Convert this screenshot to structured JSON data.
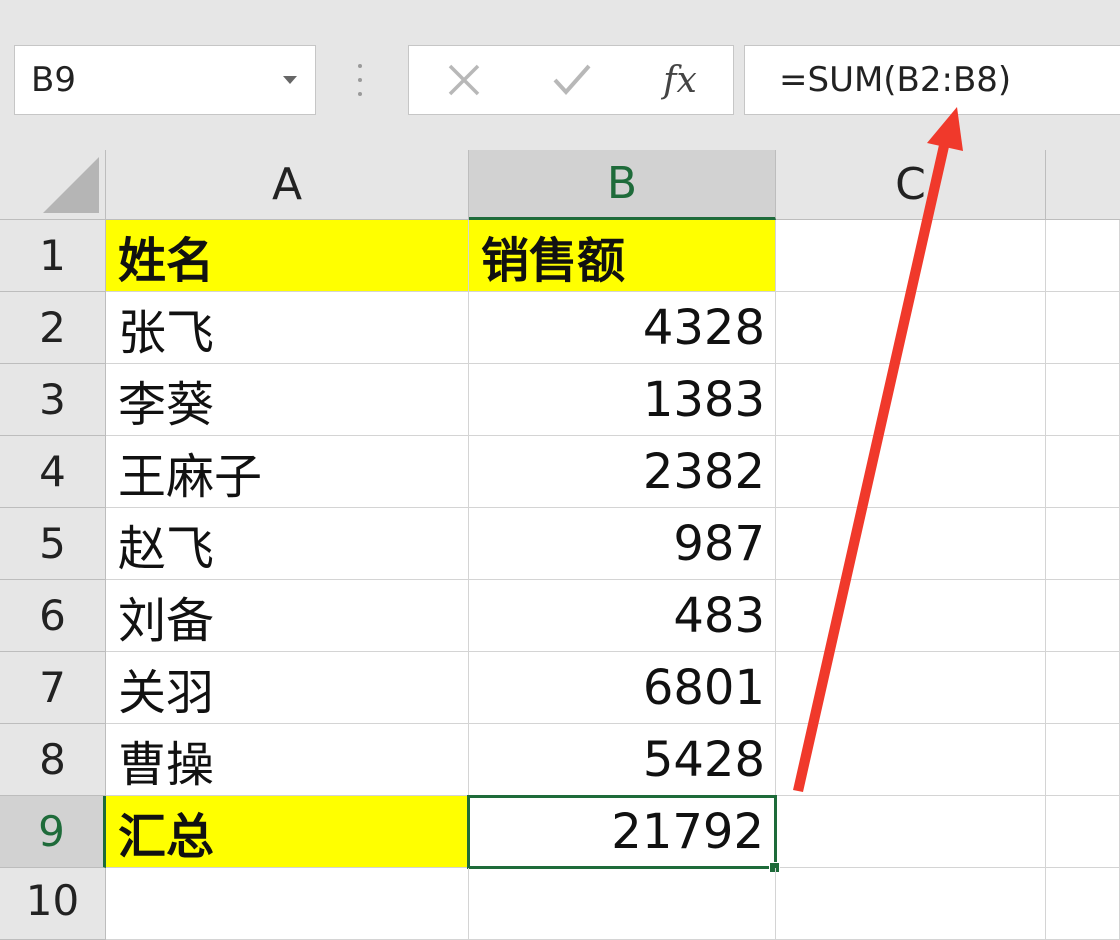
{
  "formula_bar": {
    "name_box": "B9",
    "fx_label": "fx",
    "formula": "=SUM(B2:B8)"
  },
  "sheet": {
    "columns": [
      "A",
      "B",
      "C"
    ],
    "rows": [
      {
        "num": "1",
        "name": "姓名",
        "value": "销售额"
      },
      {
        "num": "2",
        "name": "张飞",
        "value": "4328"
      },
      {
        "num": "3",
        "name": "李葵",
        "value": "1383"
      },
      {
        "num": "4",
        "name": "王麻子",
        "value": "2382"
      },
      {
        "num": "5",
        "name": "赵飞",
        "value": "987"
      },
      {
        "num": "6",
        "name": "刘备",
        "value": "483"
      },
      {
        "num": "7",
        "name": "关羽",
        "value": "6801"
      },
      {
        "num": "8",
        "name": "曹操",
        "value": "5428"
      },
      {
        "num": "9",
        "name": "汇总",
        "value": "21792"
      },
      {
        "num": "10",
        "name": "",
        "value": ""
      }
    ],
    "active_cell": "B9"
  },
  "colors": {
    "highlight_fill": "#ffff00",
    "selection_green": "#1e6b3a",
    "annotation_arrow": "#f0392b"
  },
  "icons": [
    "cancel-icon",
    "enter-check-icon",
    "insert-function-icon",
    "dropdown-arrow-icon"
  ]
}
